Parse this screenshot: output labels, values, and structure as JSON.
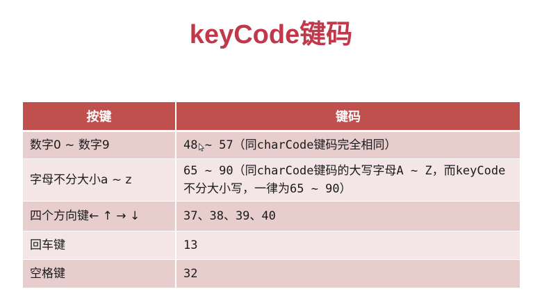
{
  "title": "keyCode键码",
  "table": {
    "headers": [
      "按键",
      "键码"
    ],
    "rows": [
      {
        "key": "数字0 ~ 数字9",
        "code": "48 ~ 57（同charCode键码完全相同）"
      },
      {
        "key": "字母不分大小a ~ z",
        "code": "65 ~ 90（同charCode键码的大写字母A ~ Z，而keyCode不分大小写，一律为65 ~ 90）"
      },
      {
        "key": "四个方向键← ↑ → ↓",
        "code": "37、38、39、40"
      },
      {
        "key": "回车键",
        "code": "13"
      },
      {
        "key": "空格键",
        "code": "32"
      }
    ]
  },
  "colors": {
    "title": "#c0394a",
    "header_bg": "#c0504d",
    "row_odd": "#e8cdcd",
    "row_even": "#f4e6e6"
  },
  "icons": {
    "cursor": "mouse-pointer-icon"
  }
}
